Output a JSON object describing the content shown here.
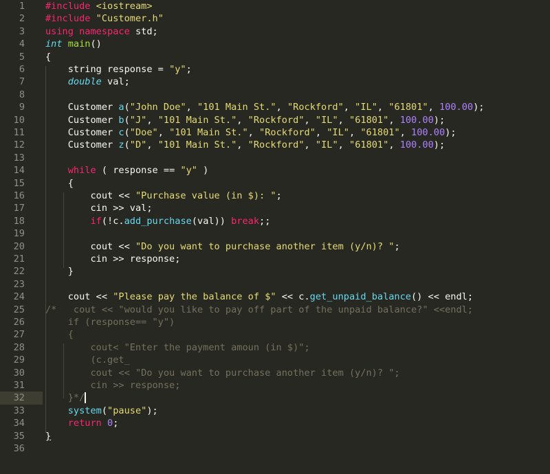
{
  "editor": {
    "theme_colors": {
      "background": "#272822",
      "keyword": "#f92672",
      "string": "#e6db74",
      "number": "#ae81ff",
      "function": "#a6e22e",
      "type": "#66d9ef",
      "comment": "#75715e",
      "text": "#f8f8f2"
    },
    "active_line": 32,
    "lines": [
      {
        "n": "1",
        "tokens": [
          {
            "c": "kw",
            "t": "#include "
          },
          {
            "c": "st",
            "t": "<iostream>"
          }
        ]
      },
      {
        "n": "2",
        "tokens": [
          {
            "c": "kw",
            "t": "#include "
          },
          {
            "c": "st",
            "t": "\"Customer.h\""
          }
        ]
      },
      {
        "n": "3",
        "tokens": [
          {
            "c": "kw",
            "t": "using namespace "
          },
          {
            "c": "",
            "t": "std;"
          }
        ]
      },
      {
        "n": "4",
        "tokens": [
          {
            "c": "ty",
            "t": "int"
          },
          {
            "c": "",
            "t": " "
          },
          {
            "c": "fn",
            "t": "main"
          },
          {
            "c": "",
            "t": "()"
          }
        ]
      },
      {
        "n": "5",
        "tokens": [
          {
            "c": "",
            "t": "{"
          }
        ]
      },
      {
        "n": "6",
        "tokens": [
          {
            "c": "",
            "t": "    string response = "
          },
          {
            "c": "st",
            "t": "\"y\""
          },
          {
            "c": "",
            "t": ";"
          }
        ]
      },
      {
        "n": "7",
        "tokens": [
          {
            "c": "",
            "t": "    "
          },
          {
            "c": "ty",
            "t": "double"
          },
          {
            "c": "",
            "t": " val;"
          }
        ]
      },
      {
        "n": "8",
        "tokens": []
      },
      {
        "n": "9",
        "tokens": [
          {
            "c": "",
            "t": "    Customer "
          },
          {
            "c": "me",
            "t": "a"
          },
          {
            "c": "",
            "t": "("
          },
          {
            "c": "st",
            "t": "\"John Doe\""
          },
          {
            "c": "",
            "t": ", "
          },
          {
            "c": "st",
            "t": "\"101 Main St.\""
          },
          {
            "c": "",
            "t": ", "
          },
          {
            "c": "st",
            "t": "\"Rockford\""
          },
          {
            "c": "",
            "t": ", "
          },
          {
            "c": "st",
            "t": "\"IL\""
          },
          {
            "c": "",
            "t": ", "
          },
          {
            "c": "st",
            "t": "\"61801\""
          },
          {
            "c": "",
            "t": ", "
          },
          {
            "c": "nu",
            "t": "100.00"
          },
          {
            "c": "",
            "t": ");"
          }
        ]
      },
      {
        "n": "10",
        "tokens": [
          {
            "c": "",
            "t": "    Customer "
          },
          {
            "c": "me",
            "t": "b"
          },
          {
            "c": "",
            "t": "("
          },
          {
            "c": "st",
            "t": "\"J\""
          },
          {
            "c": "",
            "t": ", "
          },
          {
            "c": "st",
            "t": "\"101 Main St.\""
          },
          {
            "c": "",
            "t": ", "
          },
          {
            "c": "st",
            "t": "\"Rockford\""
          },
          {
            "c": "",
            "t": ", "
          },
          {
            "c": "st",
            "t": "\"IL\""
          },
          {
            "c": "",
            "t": ", "
          },
          {
            "c": "st",
            "t": "\"61801\""
          },
          {
            "c": "",
            "t": ", "
          },
          {
            "c": "nu",
            "t": "100.00"
          },
          {
            "c": "",
            "t": ");"
          }
        ]
      },
      {
        "n": "11",
        "tokens": [
          {
            "c": "",
            "t": "    Customer "
          },
          {
            "c": "me",
            "t": "c"
          },
          {
            "c": "",
            "t": "("
          },
          {
            "c": "st",
            "t": "\"Doe\""
          },
          {
            "c": "",
            "t": ", "
          },
          {
            "c": "st",
            "t": "\"101 Main St.\""
          },
          {
            "c": "",
            "t": ", "
          },
          {
            "c": "st",
            "t": "\"Rockford\""
          },
          {
            "c": "",
            "t": ", "
          },
          {
            "c": "st",
            "t": "\"IL\""
          },
          {
            "c": "",
            "t": ", "
          },
          {
            "c": "st",
            "t": "\"61801\""
          },
          {
            "c": "",
            "t": ", "
          },
          {
            "c": "nu",
            "t": "100.00"
          },
          {
            "c": "",
            "t": ");"
          }
        ]
      },
      {
        "n": "12",
        "tokens": [
          {
            "c": "",
            "t": "    Customer "
          },
          {
            "c": "me",
            "t": "z"
          },
          {
            "c": "",
            "t": "("
          },
          {
            "c": "st",
            "t": "\"D\""
          },
          {
            "c": "",
            "t": ", "
          },
          {
            "c": "st",
            "t": "\"101 Main St.\""
          },
          {
            "c": "",
            "t": ", "
          },
          {
            "c": "st",
            "t": "\"Rockford\""
          },
          {
            "c": "",
            "t": ", "
          },
          {
            "c": "st",
            "t": "\"IL\""
          },
          {
            "c": "",
            "t": ", "
          },
          {
            "c": "st",
            "t": "\"61801\""
          },
          {
            "c": "",
            "t": ", "
          },
          {
            "c": "nu",
            "t": "100.00"
          },
          {
            "c": "",
            "t": ");"
          }
        ]
      },
      {
        "n": "13",
        "tokens": []
      },
      {
        "n": "14",
        "tokens": [
          {
            "c": "",
            "t": "    "
          },
          {
            "c": "kw",
            "t": "while"
          },
          {
            "c": "",
            "t": " ( response == "
          },
          {
            "c": "st",
            "t": "\"y\""
          },
          {
            "c": "",
            "t": " )"
          }
        ]
      },
      {
        "n": "15",
        "tokens": [
          {
            "c": "",
            "t": "    {"
          }
        ]
      },
      {
        "n": "16",
        "tokens": [
          {
            "c": "",
            "t": "        cout << "
          },
          {
            "c": "st",
            "t": "\"Purchase value (in $): \""
          },
          {
            "c": "",
            "t": ";"
          }
        ]
      },
      {
        "n": "17",
        "tokens": [
          {
            "c": "",
            "t": "        cin >> val;"
          }
        ]
      },
      {
        "n": "18",
        "tokens": [
          {
            "c": "",
            "t": "        "
          },
          {
            "c": "kw",
            "t": "if"
          },
          {
            "c": "",
            "t": "(!c."
          },
          {
            "c": "me",
            "t": "add_purchase"
          },
          {
            "c": "",
            "t": "(val)) "
          },
          {
            "c": "kw",
            "t": "break"
          },
          {
            "c": "",
            "t": ";;"
          }
        ]
      },
      {
        "n": "19",
        "tokens": []
      },
      {
        "n": "20",
        "tokens": [
          {
            "c": "",
            "t": "        cout << "
          },
          {
            "c": "st",
            "t": "\"Do you want to purchase another item (y/n)? \""
          },
          {
            "c": "",
            "t": ";"
          }
        ]
      },
      {
        "n": "21",
        "tokens": [
          {
            "c": "",
            "t": "        cin >> response;"
          }
        ]
      },
      {
        "n": "22",
        "tokens": [
          {
            "c": "",
            "t": "    }"
          }
        ]
      },
      {
        "n": "23",
        "tokens": []
      },
      {
        "n": "24",
        "tokens": [
          {
            "c": "",
            "t": "    cout << "
          },
          {
            "c": "st",
            "t": "\"Please pay the balance of $\""
          },
          {
            "c": "",
            "t": " << c."
          },
          {
            "c": "me",
            "t": "get_unpaid_balance"
          },
          {
            "c": "",
            "t": "() << endl;"
          }
        ]
      },
      {
        "n": "25",
        "tokens": [
          {
            "c": "cm",
            "t": "/*   cout << \"would you like to pay off part of the unpaid balance?\" <<endl;"
          }
        ]
      },
      {
        "n": "26",
        "tokens": [
          {
            "c": "cm",
            "t": "    if (response== \"y\")"
          }
        ]
      },
      {
        "n": "27",
        "tokens": [
          {
            "c": "cm",
            "t": "    {"
          }
        ]
      },
      {
        "n": "28",
        "tokens": [
          {
            "c": "cm",
            "t": "        cout< \"Enter the payment amoun (in $)\";"
          }
        ]
      },
      {
        "n": "29",
        "tokens": [
          {
            "c": "cm",
            "t": "        (c.get_"
          }
        ]
      },
      {
        "n": "30",
        "tokens": [
          {
            "c": "cm",
            "t": "        cout << \"Do you want to purchase another item (y/n)? \";"
          }
        ]
      },
      {
        "n": "31",
        "tokens": [
          {
            "c": "cm",
            "t": "        cin >> response;"
          }
        ]
      },
      {
        "n": "32",
        "tokens": [
          {
            "c": "cm",
            "t": "    }*/"
          }
        ],
        "caret": true
      },
      {
        "n": "33",
        "tokens": [
          {
            "c": "",
            "t": "    "
          },
          {
            "c": "me",
            "t": "system"
          },
          {
            "c": "",
            "t": "("
          },
          {
            "c": "st",
            "t": "\"pause\""
          },
          {
            "c": "",
            "t": ");"
          }
        ]
      },
      {
        "n": "34",
        "tokens": [
          {
            "c": "",
            "t": "    "
          },
          {
            "c": "kw",
            "t": "return"
          },
          {
            "c": "",
            "t": " "
          },
          {
            "c": "nu",
            "t": "0"
          },
          {
            "c": "",
            "t": ";"
          }
        ]
      },
      {
        "n": "35",
        "tokens": [
          {
            "c": "brace-ul",
            "t": "}"
          }
        ]
      },
      {
        "n": "36",
        "tokens": []
      }
    ]
  }
}
